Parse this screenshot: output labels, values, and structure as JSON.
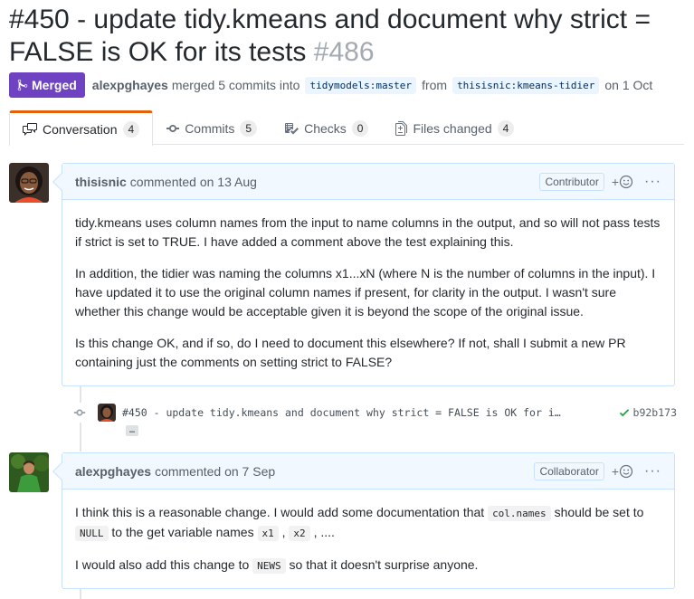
{
  "pr": {
    "title": "#450 - update tidy.kmeans and document why strict = FALSE is OK for its tests",
    "number": "#486",
    "state_label": "Merged",
    "author": "alexpghayes",
    "action": "merged 5 commits into",
    "base_branch": "tidymodels:master",
    "from_text": "from",
    "head_branch": "thisisnic:kmeans-tidier",
    "date_text": "on 1 Oct"
  },
  "tabs": [
    {
      "label": "Conversation",
      "count": "4",
      "icon": "comment-discussion-icon"
    },
    {
      "label": "Commits",
      "count": "5",
      "icon": "git-commit-icon"
    },
    {
      "label": "Checks",
      "count": "0",
      "icon": "checklist-icon"
    },
    {
      "label": "Files changed",
      "count": "4",
      "icon": "file-diff-icon"
    }
  ],
  "comments": [
    {
      "author": "thisisnic",
      "meta": "commented on 13 Aug",
      "role": "Contributor",
      "reaction": "+",
      "paragraphs": [
        "tidy.kmeans uses column names from the input to name columns in the output, and so will not pass tests if strict is set to TRUE. I have added a comment above the test explaining this.",
        "In addition, the tidier was naming the columns x1...xN (where N is the number of columns in the input). I have updated it to use the original column names if present, for clarity in the output. I wasn't sure whether this change would be acceptable given it is beyond the scope of the original issue.",
        "Is this change OK, and if so, do I need to document this elsewhere? If not, shall I submit a new PR containing just the comments on setting strict to FALSE?"
      ]
    },
    {
      "author": "alexpghayes",
      "meta": "commented on 7 Sep",
      "role": "Collaborator",
      "reaction": "+",
      "p1": {
        "a": "I think this is a reasonable change. I would add some documentation that",
        "code1": "col.names",
        "b": "should be set to",
        "code2": "NULL",
        "c": "to the get variable names",
        "code3": "x1",
        "d": ",",
        "code4": "x2",
        "e": ", ...."
      },
      "p2": {
        "a": "I would also add this change to",
        "code": "NEWS",
        "b": "so that it doesn't surprise anyone."
      }
    }
  ],
  "commit": {
    "message": "#450 - update tidy.kmeans and document why strict = FALSE is OK for i…",
    "sha": "b92b173",
    "ellipsis": "…",
    "status_color": "#28a745"
  },
  "colors": {
    "merged": "#6f42c1",
    "header_bg": "#f1f8ff",
    "header_border": "#c8e1ff",
    "active_tab_accent": "#e36209"
  }
}
